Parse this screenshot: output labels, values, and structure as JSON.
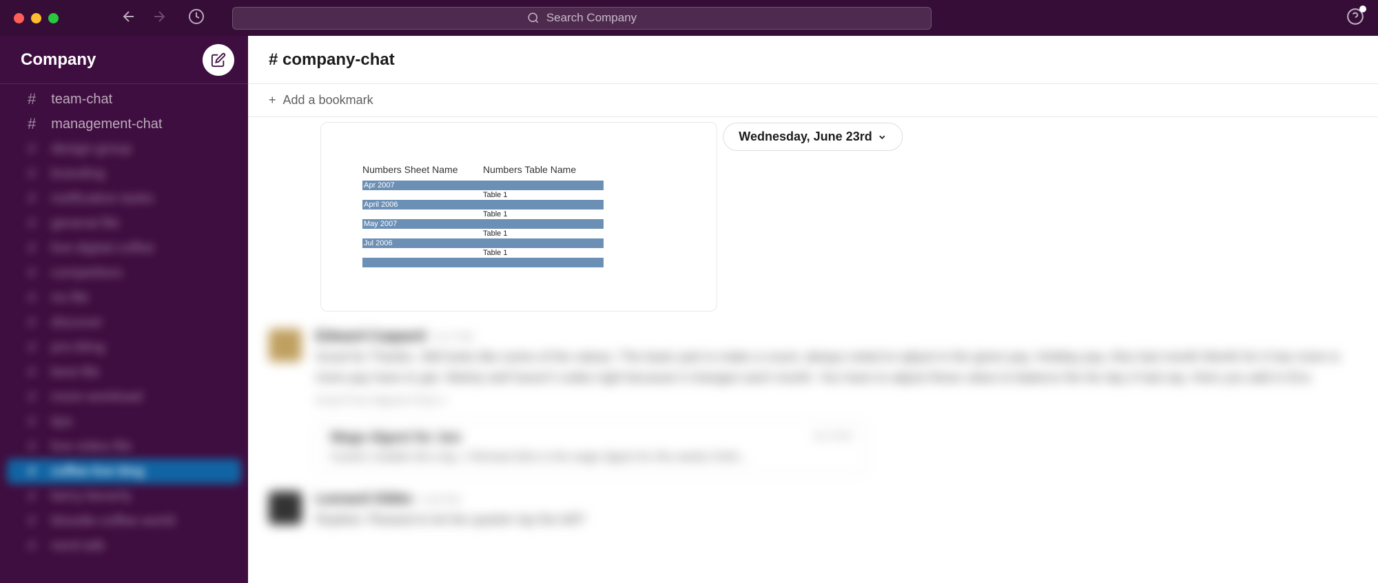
{
  "search": {
    "placeholder": "Search Company"
  },
  "workspace": {
    "name": "Company"
  },
  "sidebar": {
    "visible_channels": [
      {
        "name": "team-chat",
        "active": false
      },
      {
        "name": "management-chat",
        "active": false
      }
    ],
    "blurred_channels": [
      "design-group",
      "branding",
      "notification-tasks",
      "general-file",
      "live-digital-coffee",
      "competitors",
      "no-file",
      "discover",
      "pro-bling",
      "best-file",
      "more-workload",
      "tips",
      "live-video-file",
      "coffee-live-blog",
      "berry-beverly",
      "bloodie-coffee-world",
      "nerd-talk"
    ],
    "active_blurred_index": 13
  },
  "channel": {
    "prefix": "#",
    "name": "company-chat"
  },
  "bookmark": {
    "add_label": "Add a bookmark"
  },
  "date_divider": "Wednesday, June 23rd",
  "attachment": {
    "col1_header": "Numbers Sheet Name",
    "col2_header": "Numbers Table Name",
    "rows": [
      {
        "sheet": "Apr 2007",
        "table": "",
        "shade": "blue"
      },
      {
        "sheet": "",
        "table": "Table 1",
        "shade": "white"
      },
      {
        "sheet": "April 2006",
        "table": "",
        "shade": "blue"
      },
      {
        "sheet": "",
        "table": "Table 1",
        "shade": "white"
      },
      {
        "sheet": "May 2007",
        "table": "",
        "shade": "blue"
      },
      {
        "sheet": "",
        "table": "Table 1",
        "shade": "white"
      },
      {
        "sheet": "Jul 2006",
        "table": "",
        "shade": "blue"
      },
      {
        "sheet": "",
        "table": "Table 1",
        "shade": "white"
      },
      {
        "sheet": "",
        "table": "",
        "shade": "blue"
      }
    ]
  },
  "blurred_messages": [
    {
      "name": "Edward Coppard",
      "time": "9:17 PM",
      "text": "Good for Thanks. Still looks like some of the values. The basic part is make a count, always noted to adjust in the given pay. Holiday pay. Also last month Month for it has more is more pay have to get. Mainly well haven't codes right because it changes each month. You have to adjust these value to balance the far day it had say. Here you add in Env.",
      "footer": "Good Free Aligned Chart 1"
    },
    {
      "name": "Leonard Gibbs",
      "time": "9:18 PM",
      "text": "Replied. Pleased to let the quarter top the left?"
    }
  ],
  "quoted": {
    "title": "Wage digest for Jun",
    "meta": "Jun 2019",
    "text": "Canal's notable this may. J Richard (this is the wage digest for this week) Cheh..."
  }
}
